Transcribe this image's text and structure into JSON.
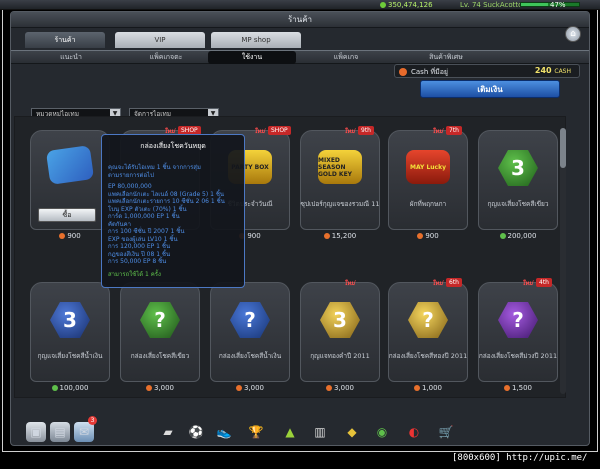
{
  "status": {
    "money": "350,474,126",
    "level": "Lv. 74 SuckAcotto",
    "percent": "47%",
    "percent_value": 0.47
  },
  "window": {
    "title": "ร้านค้า",
    "tabs": [
      "ร้านค้า",
      "VIP",
      "MP shop"
    ],
    "subtabs": [
      "แนะนำ",
      "แพ็คเกจตะ",
      "ใช้งาน",
      "แพ็คเกจ",
      "สินค้าพิเศษ"
    ],
    "active_subtab": "ใช้งาน",
    "filter1": "หมวดหมู่ไอเทม",
    "filter2": "จัดการไอเทม",
    "cash_label": "Cash ที่มีอยู่",
    "cash_value": "240",
    "cash_unit": "CASH",
    "topup_label": "เติมเงิน"
  },
  "tooltip": {
    "title": "กล่องเสี่ยงโชควันหยุด",
    "lines": [
      "คุณจะได้รับไอเทม 1 ชิ้น จากการสุ่ม",
      "ตามรายการต่อไป",
      "",
      "EP 80,000,000",
      "แพคเลือกนักเตะ ไลเนอ์ 08 (Grade 5) 1 ชิ้น",
      "แพคเลือกนักเตะรายการ 10 ซีซั่น 2 06 1 ชิ้น",
      "โบนุ EXP ตัวเตะ (70%) 1 ชิ้น",
      "การ์ด 1,000,000 EP 1 ชิ้น",
      "คัดกันคา",
      "การ 100 ซีซั่น ปี 2007 1 ชิ้น",
      "EXP ของผู้เล่น LV10 1 ชิ้น",
      "การ 120,000 EP 1 ชิ้น",
      "กฎของสีเงิน ปี 08 1 ชิ้น",
      "การ 50,000 EP 8 ชิ้น"
    ],
    "footer": "สามารถใช้ได้ 1 ครั้ง"
  },
  "items": [
    {
      "name": "",
      "price": "900",
      "coin": "orange",
      "new": false,
      "rank": "",
      "kind": "box",
      "buy": "ซื้อ"
    },
    {
      "name": "",
      "price": "",
      "coin": "orange",
      "new": true,
      "rank": "SHOP",
      "kind": "none"
    },
    {
      "name": "ชีวิตประจำวันณี",
      "price": "900",
      "coin": "orange",
      "new": true,
      "rank": "SHOP",
      "kind": "bag-yellow",
      "bag_text": "PARTY BOX"
    },
    {
      "name": "ซุปเปอร์กุญแจของรวมณี 11",
      "price": "15,200",
      "coin": "orange",
      "new": true,
      "rank": "9th",
      "kind": "bag-yellow",
      "bag_text": "MIXED SEASON GOLD KEY"
    },
    {
      "name": "ผักที่พฤกษภา",
      "price": "900",
      "coin": "orange",
      "new": true,
      "rank": "7th",
      "kind": "bag-red",
      "bag_text": "MAY Lucky"
    },
    {
      "name": "กุญแจเสี่ยงโชคสีเขียว",
      "price": "200,000",
      "coin": "green",
      "new": false,
      "rank": "",
      "kind": "hex-green3",
      "glyph": "3"
    },
    {
      "name": "กุญแจเสี่ยงโชคสีน้ำเงิน",
      "price": "100,000",
      "coin": "green",
      "new": false,
      "rank": "",
      "kind": "hex-blue3",
      "glyph": "3"
    },
    {
      "name": "กล่องเสี่ยงโชคสีเขียว",
      "price": "3,000",
      "coin": "orange",
      "new": false,
      "rank": "",
      "kind": "hex-green",
      "glyph": "?"
    },
    {
      "name": "กล่องเสี่ยงโชคสีน้ำเงิน",
      "price": "3,000",
      "coin": "orange",
      "new": false,
      "rank": "",
      "kind": "hex-blue",
      "glyph": "?"
    },
    {
      "name": "กุญแจทองคำปี 2011",
      "price": "3,000",
      "coin": "orange",
      "new": true,
      "rank": "",
      "kind": "hex-gold3",
      "glyph": "3"
    },
    {
      "name": "กล่องเสี่ยงโชคสีทองปี 2011",
      "price": "1,000",
      "coin": "orange",
      "new": true,
      "rank": "6th",
      "kind": "hex-gold",
      "glyph": "?"
    },
    {
      "name": "กล่องเสี่ยงโชคสีม่วงปี 2011",
      "price": "1,500",
      "coin": "orange",
      "new": true,
      "rank": "4th",
      "kind": "hex-purple",
      "glyph": "?"
    }
  ],
  "new_label": "ใหม่",
  "taskbar_badge": "3",
  "watermark": "[800x600] http://upic.me/"
}
